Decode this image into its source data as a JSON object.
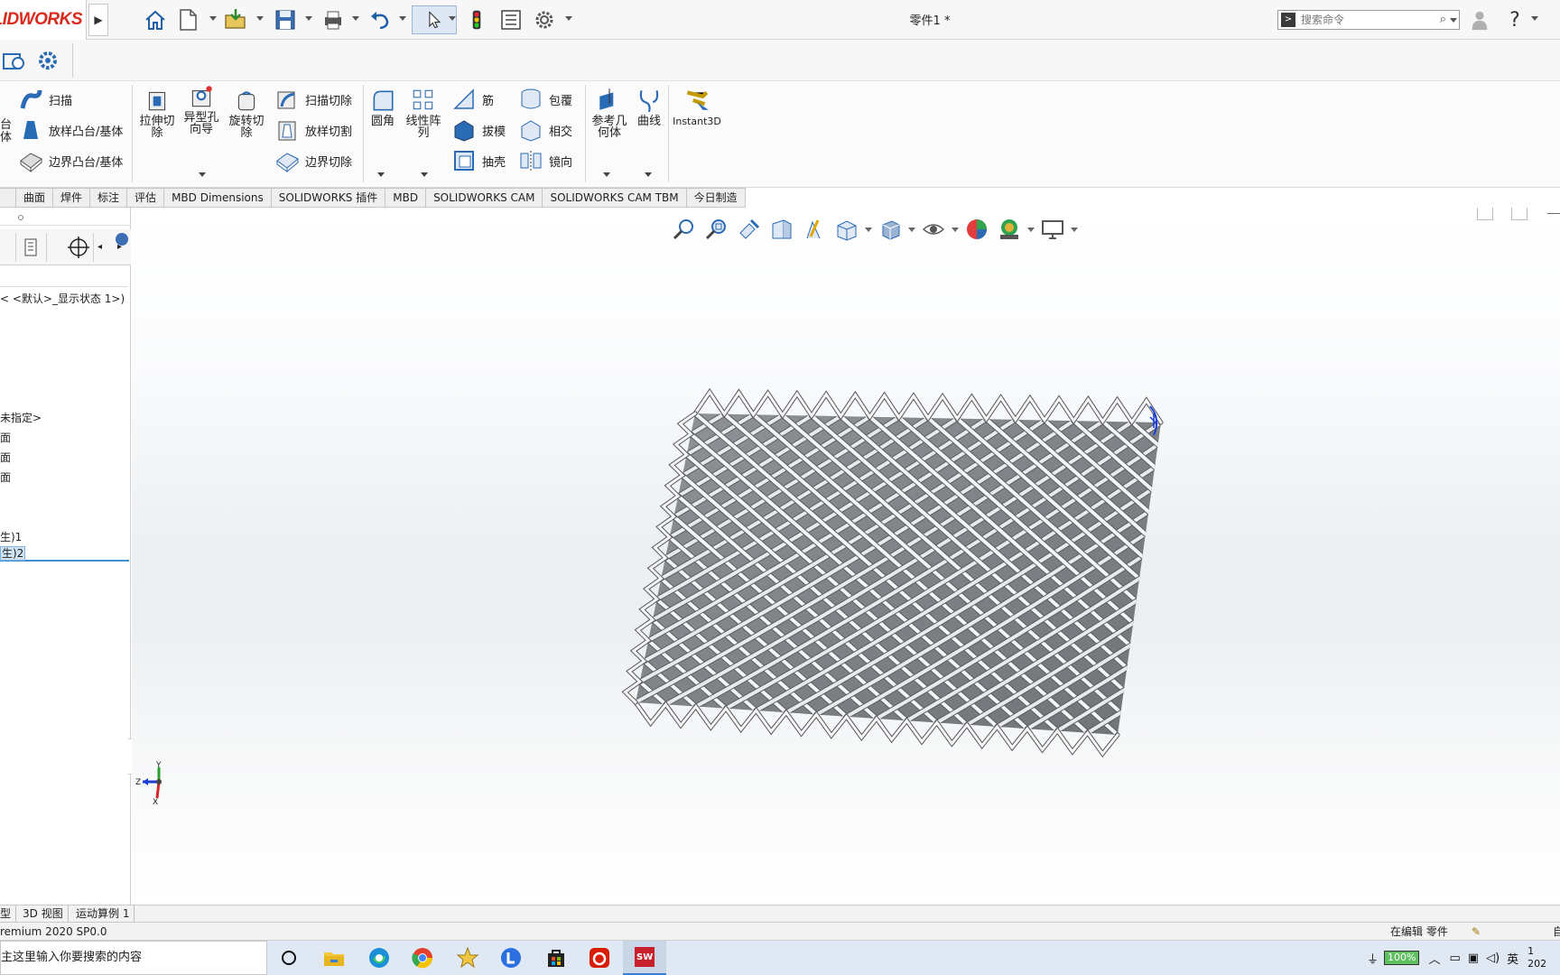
{
  "app": {
    "logo_text": "LIDWORKS",
    "document_title": "零件1 *",
    "search_placeholder": "搜索命令"
  },
  "ribbon": {
    "group1": [
      {
        "label": "扫描",
        "icon": "sweep-icon"
      },
      {
        "label": "放样凸台/基体",
        "icon": "loft-boss-icon"
      },
      {
        "label": "边界凸台/基体",
        "icon": "boundary-boss-icon"
      }
    ],
    "partial_left": {
      "line1": "台",
      "line2": "体"
    },
    "big_buttons": [
      {
        "label": "拉伸切除",
        "lines": [
          "拉伸切",
          "除"
        ],
        "icon": "extrude-cut-icon"
      },
      {
        "label": "异型孔向导",
        "lines": [
          "异型孔",
          "向导"
        ],
        "icon": "hole-wizard-icon"
      },
      {
        "label": "旋转切除",
        "lines": [
          "旋转切",
          "除"
        ],
        "icon": "revolve-cut-icon"
      }
    ],
    "group2": [
      {
        "label": "扫描切除",
        "icon": "swept-cut-icon"
      },
      {
        "label": "放样切割",
        "icon": "lofted-cut-icon"
      },
      {
        "label": "边界切除",
        "icon": "boundary-cut-icon"
      }
    ],
    "group3_big": [
      {
        "label": "圆角",
        "lines": [
          "圆角"
        ],
        "icon": "fillet-icon"
      },
      {
        "label": "线性阵列",
        "lines": [
          "线性阵",
          "列"
        ],
        "icon": "linear-pattern-icon"
      }
    ],
    "group3": [
      {
        "label": "筋",
        "icon": "rib-icon"
      },
      {
        "label": "拔模",
        "icon": "draft-icon"
      },
      {
        "label": "抽壳",
        "icon": "shell-icon"
      }
    ],
    "group4": [
      {
        "label": "包覆",
        "icon": "wrap-icon"
      },
      {
        "label": "相交",
        "icon": "intersect-icon"
      },
      {
        "label": "镜向",
        "icon": "mirror-icon"
      }
    ],
    "group5_big": [
      {
        "label": "参考几何体",
        "lines": [
          "参考几",
          "何体"
        ],
        "icon": "reference-geometry-icon"
      },
      {
        "label": "曲线",
        "lines": [
          "曲线"
        ],
        "icon": "curves-icon"
      },
      {
        "label": "Instant3D",
        "lines": [
          "Instant3D"
        ],
        "icon": "instant3d-icon"
      }
    ]
  },
  "tabs": [
    "曲面",
    "焊件",
    "标注",
    "评估",
    "MBD Dimensions",
    "SOLIDWORKS 插件",
    "MBD",
    "SOLIDWORKS CAM",
    "SOLIDWORKS CAM TBM",
    "今日制造"
  ],
  "tree": {
    "display_state": "< <默认>_显示状态 1>)",
    "material": "未指定>",
    "planes": [
      "面",
      "面",
      "面"
    ],
    "features": [
      "生)1",
      "生)2"
    ]
  },
  "view_tabs": [
    "型",
    "3D 视图",
    "运动算例 1"
  ],
  "status": {
    "version": "remium 2020 SP0.0",
    "editing": "在编辑 零件",
    "right_char": "自"
  },
  "taskbar": {
    "search_text": "主这里输入你要搜索的内容",
    "battery": "100%",
    "ime": "英",
    "clock_1": "1",
    "clock_2": "202"
  },
  "triad": {
    "x": "X",
    "y": "Y",
    "z": "Z"
  },
  "colors": {
    "brand_red": "#da291c",
    "selection_blue": "#3d8fd1",
    "mesh_grey": "#8a8d90"
  }
}
